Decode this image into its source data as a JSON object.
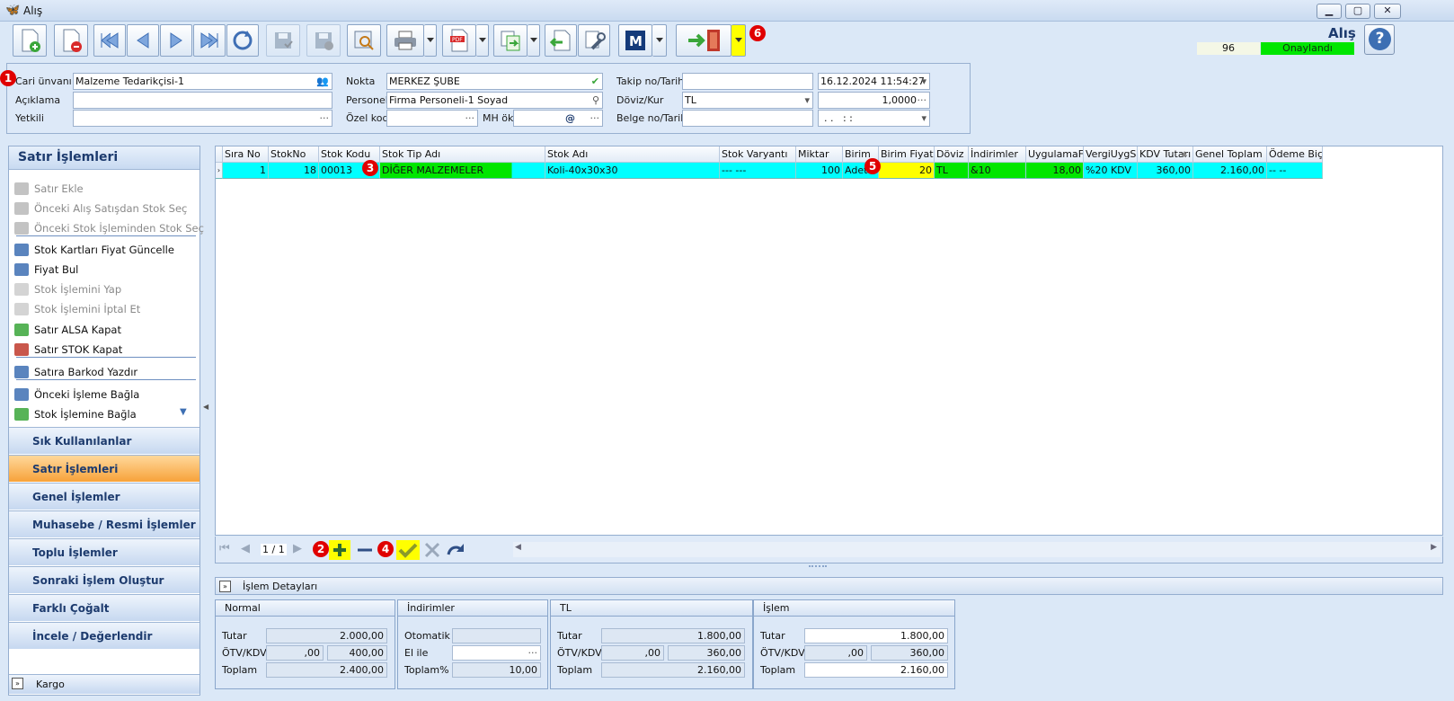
{
  "window": {
    "title": "Alış",
    "min": "▁",
    "max": "▢",
    "close": "✕"
  },
  "header": {
    "title": "Alış",
    "doc_no": "96",
    "status": "Onaylandı",
    "help": "?"
  },
  "markers": [
    "1",
    "2",
    "3",
    "4",
    "5",
    "6"
  ],
  "form": {
    "cari_label": "Cari ünvanı",
    "cari_value": "Malzeme Tedarikçisi-1",
    "aciklama_label": "Açıklama",
    "aciklama_value": "",
    "yetkili_label": "Yetkili",
    "yetkili_value": "",
    "nokta_label": "Nokta",
    "nokta_value": "MERKEZ ŞUBE",
    "personel_label": "Personel",
    "personel_value": "Firma Personeli-1 Soyad",
    "ozelkod_label": "Özel kod",
    "ozelkod_value": "",
    "mhok_label": "MH ök",
    "mhok_value": "@",
    "takip_label": "Takip no/Tarih",
    "takip_value": "",
    "takip_date": "16.12.2024 11:54:27",
    "doviz_label": "Döviz/Kur",
    "doviz_value": "TL",
    "kur_value": "1,0000",
    "belge_label": "Belge no/Tarih",
    "belge_value": "",
    "belge_date": ". .   : :",
    "ellipsis": "···"
  },
  "leftpanel": {
    "title": "Satır İşlemleri",
    "items": [
      {
        "label": "Satır Ekle",
        "icon": "plus-icon"
      },
      {
        "label": "Önceki Alış Satışdan Stok Seç",
        "icon": "return-icon"
      },
      {
        "label": "Önceki Stok İşleminden Stok Seç",
        "icon": "return-icon"
      },
      {
        "label": "Stok Kartları Fiyat Güncelle",
        "icon": "price-update-icon"
      },
      {
        "label": "Fiyat Bul",
        "icon": "price-tag-icon"
      },
      {
        "label": "Stok İşlemini Yap",
        "icon": "forward-icon"
      },
      {
        "label": "Stok İşlemini İptal Et",
        "icon": "undo-icon"
      },
      {
        "label": "Satır ALSA Kapat",
        "icon": "check-doc-icon"
      },
      {
        "label": "Satır STOK Kapat",
        "icon": "check-doc-red-icon"
      },
      {
        "label": "Satıra Barkod Yazdır",
        "icon": "barcode-icon"
      },
      {
        "label": "Önceki İşleme Bağla",
        "icon": "link-icon"
      },
      {
        "label": "Stok İşlemine Bağla",
        "icon": "stock-link-icon"
      }
    ],
    "groups": [
      "Sık Kullanılanlar",
      "Satır İşlemleri",
      "Genel İşlemler",
      "Muhasebe / Resmi İşlemler",
      "Toplu İşlemler",
      "Sonraki İşlem Oluştur",
      "Farklı Çoğalt",
      "İncele / Değerlendir"
    ],
    "kargo": "Kargo"
  },
  "grid": {
    "columns": [
      "Sıra No",
      "StokNo",
      "Stok Kodu",
      "Stok Tip Adı",
      "Stok Adı",
      "Stok Varyantı",
      "Miktar",
      "Birim",
      "Birim Fiyat",
      "Döviz",
      "İndirimler",
      "UygulamaFiy",
      "VergiUygSet",
      "KDV Tutarı",
      "Genel Toplam",
      "Ödeme Biçim"
    ],
    "row": [
      "1",
      "18",
      "00013",
      "DİĞER MALZEMELER",
      "Koli-40x30x30",
      "--- ---",
      "100",
      "Adet",
      "20",
      "TL",
      "&10",
      "18,00",
      "%20 KDV",
      "360,00",
      "2.160,00",
      "-- --"
    ],
    "pager": "1 / 1"
  },
  "details": {
    "title": "İşlem Detayları",
    "normal": {
      "title": "Normal",
      "tutar_label": "Tutar",
      "tutar": "2.000,00",
      "otv_label": "ÖTV/KDV",
      "otv": ",00",
      "kdv": "400,00",
      "toplam_label": "Toplam",
      "toplam": "2.400,00"
    },
    "indirimler": {
      "title": "İndirimler",
      "otomatik_label": "Otomatik",
      "otomatik": "",
      "elile_label": "El ile",
      "elile": "",
      "toplamp_label": "Toplam%",
      "toplamp": "10,00"
    },
    "tl": {
      "title": "TL",
      "tutar_label": "Tutar",
      "tutar": "1.800,00",
      "otv_label": "ÖTV/KDV",
      "otv": ",00",
      "kdv": "360,00",
      "toplam_label": "Toplam",
      "toplam": "2.160,00"
    },
    "islem": {
      "title": "İşlem",
      "tutar_label": "Tutar",
      "tutar": "1.800,00",
      "otv_label": "ÖTV/KDV",
      "otv": ",00",
      "kdv": "360,00",
      "toplam_label": "Toplam",
      "toplam": "2.160,00"
    }
  },
  "colors": {
    "status_green": "#00e600",
    "row_cyan": "#00ffff",
    "highlight_yellow": "#ffff00",
    "accent_orange": "#f7a23a",
    "marker_red": "#e00000"
  }
}
